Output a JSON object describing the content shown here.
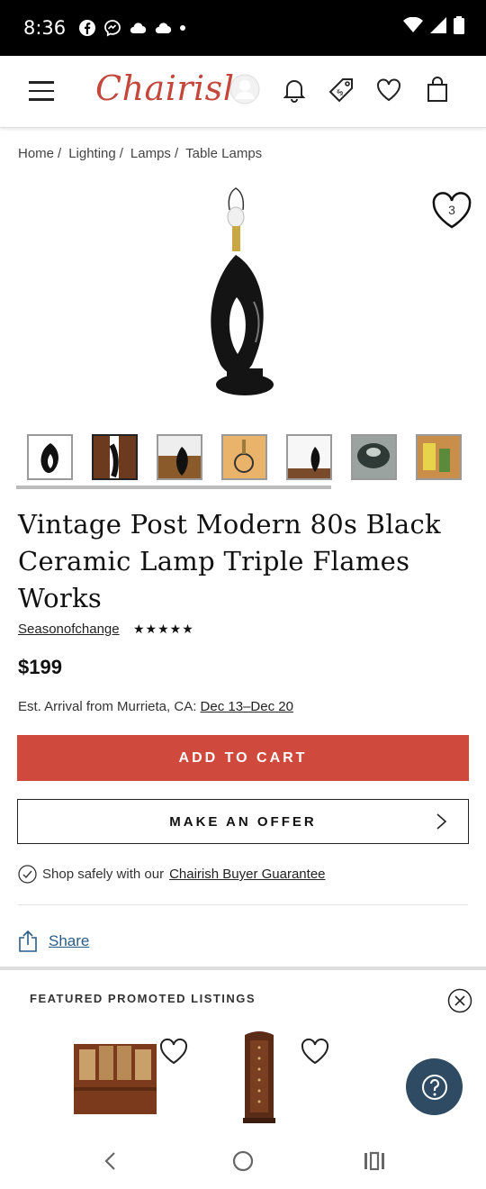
{
  "status_bar": {
    "time": "8:36"
  },
  "header": {
    "logo": "Chairish"
  },
  "breadcrumb": [
    {
      "label": "Home"
    },
    {
      "label": "Lighting"
    },
    {
      "label": "Lamps"
    },
    {
      "label": "Table Lamps"
    }
  ],
  "product": {
    "favorite_count": "3",
    "title": "Vintage Post Modern 80s Black Ceramic Lamp Triple Flames Works",
    "seller": "Seasonofchange",
    "rating_stars": "★★★★★",
    "price": "$199",
    "arrival_prefix": "Est. Arrival from Murrieta, CA:",
    "arrival_date": "Dec 13–Dec 20"
  },
  "actions": {
    "add_to_cart": "ADD TO CART",
    "make_offer": "MAKE AN OFFER"
  },
  "guarantee": {
    "prefix": "Shop safely with our",
    "link": "Chairish Buyer Guarantee"
  },
  "share": {
    "label": "Share"
  },
  "promoted": {
    "title": "FEATURED PROMOTED LISTINGS"
  },
  "colors": {
    "brand": "#c3473a",
    "cta": "#cf4a3c",
    "link": "#2a5c88",
    "help": "#2e4b63"
  }
}
